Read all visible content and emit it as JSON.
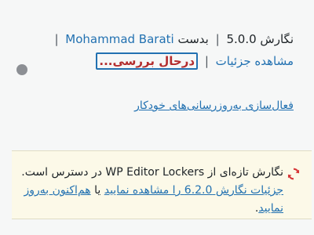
{
  "plugin_row": {
    "version_text": "نگارش 5.0.0",
    "by_text": "بدست",
    "author": "Mohammad Barati",
    "view_details": "مشاهده جزئیات",
    "separator": "|",
    "status": "درحال بررسی..."
  },
  "auto_update_link": "فعال‌سازی به‌روزرسانی‌های خودکار",
  "update_notice": {
    "text_before": "نگارش تازه‌ای از",
    "plugin_name": "WP Editor Lockers",
    "text_after": "در دسترس است.",
    "details_link": "جزئیات نگارش 6.2.0 را مشاهده نمایید",
    "or_text": "یا",
    "update_link": "هم‌اکنون به‌روز نمایید",
    "end": "."
  },
  "colors": {
    "link": "#2271b1",
    "status": "#b32d2e",
    "notice_bg": "#fcf9e8",
    "update_icon": "#d63638"
  },
  "icons": {
    "status_dot": "circle-icon",
    "update": "update-icon"
  }
}
